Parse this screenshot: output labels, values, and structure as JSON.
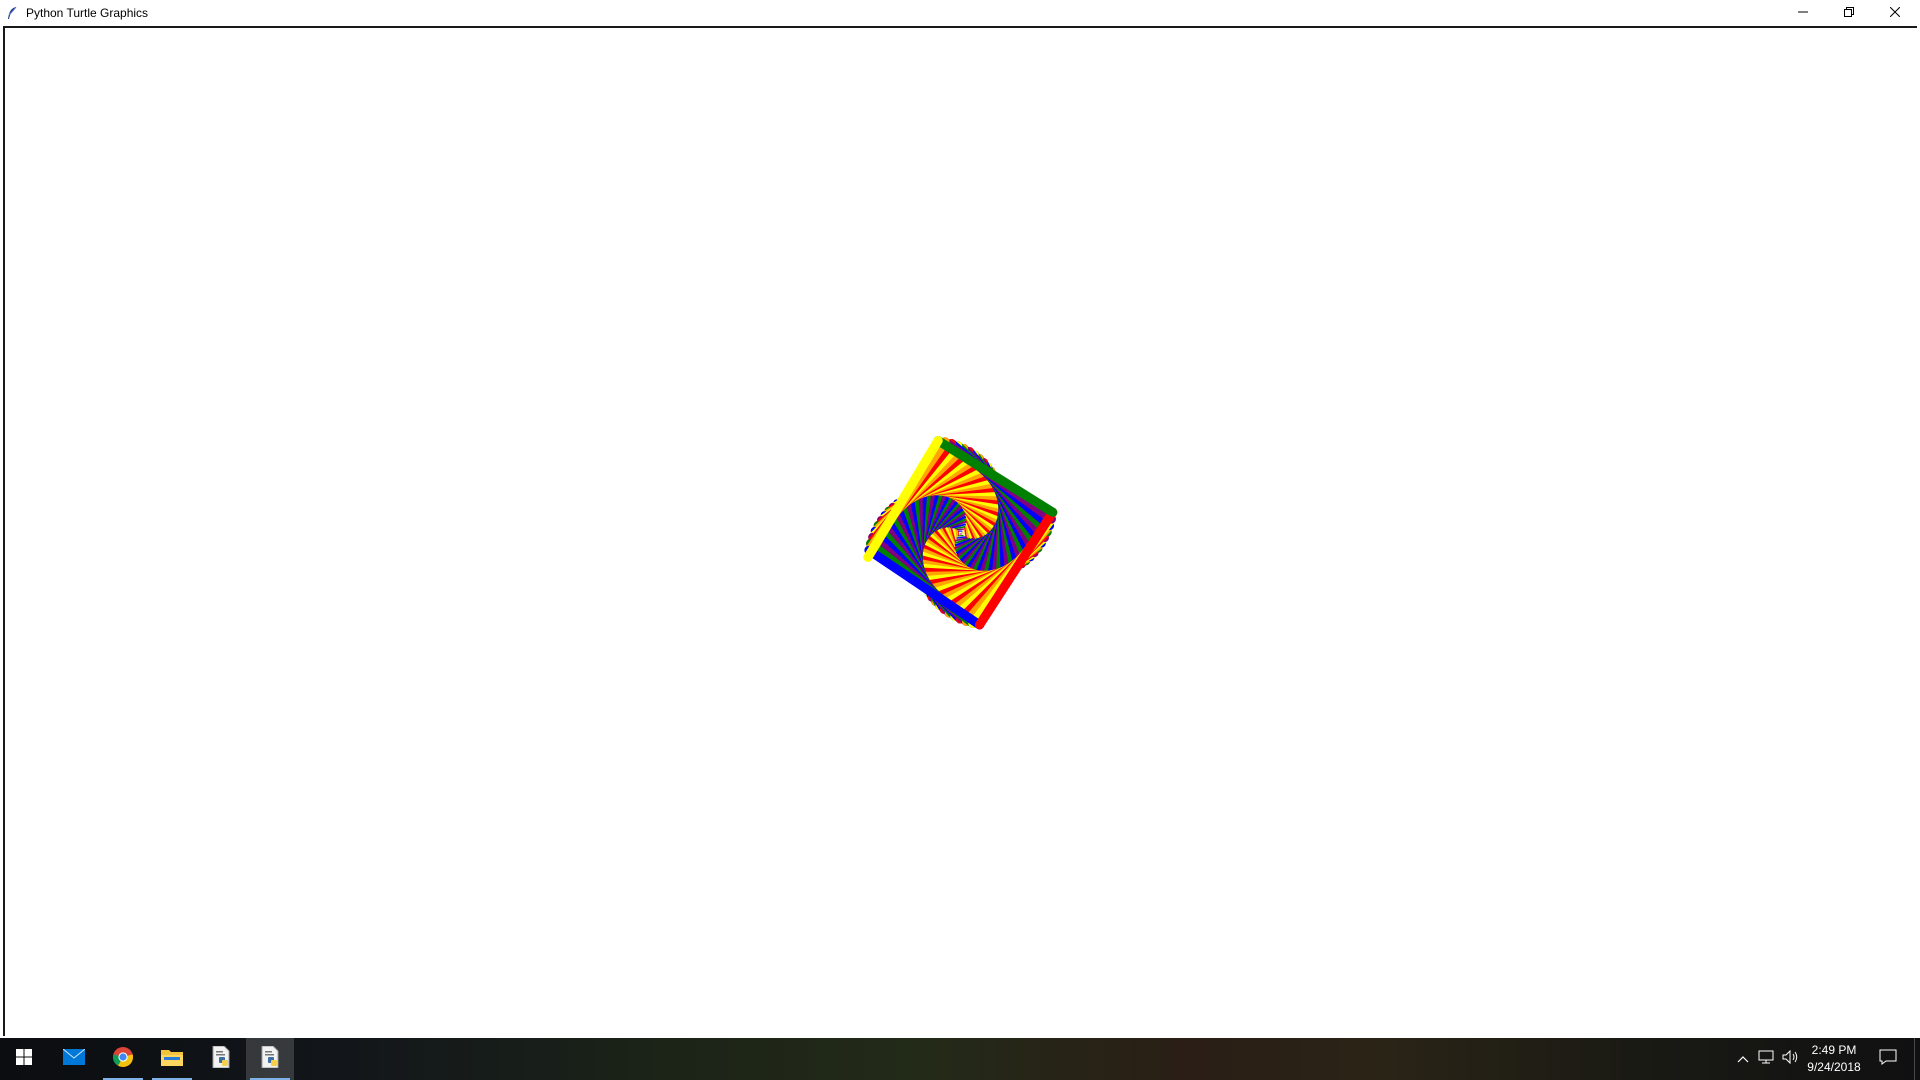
{
  "window": {
    "title": "Python Turtle Graphics",
    "controls": {
      "minimize_icon": "minimize-icon",
      "maximize_icon": "restore-icon",
      "close_icon": "close-icon"
    }
  },
  "canvas": {
    "background": "#ffffff",
    "drawing": {
      "description_colors": [
        "#800080",
        "#ffa500",
        "#0000ff",
        "#ff0000",
        "#008000",
        "#ffff00"
      ],
      "pattern": "square-spiral"
    }
  },
  "taskbar": {
    "apps": [
      {
        "name": "start",
        "icon": "windows-logo-icon"
      },
      {
        "name": "mail",
        "icon": "mail-icon"
      },
      {
        "name": "chrome",
        "icon": "chrome-icon",
        "running": true
      },
      {
        "name": "file-explorer",
        "icon": "folder-icon",
        "running": true
      },
      {
        "name": "python-idle",
        "icon": "python-idle-icon"
      },
      {
        "name": "python-idle",
        "icon": "python-idle-icon",
        "running": true,
        "active": true
      }
    ],
    "clock": {
      "time": "2:49 PM",
      "date": "9/24/2018"
    }
  }
}
